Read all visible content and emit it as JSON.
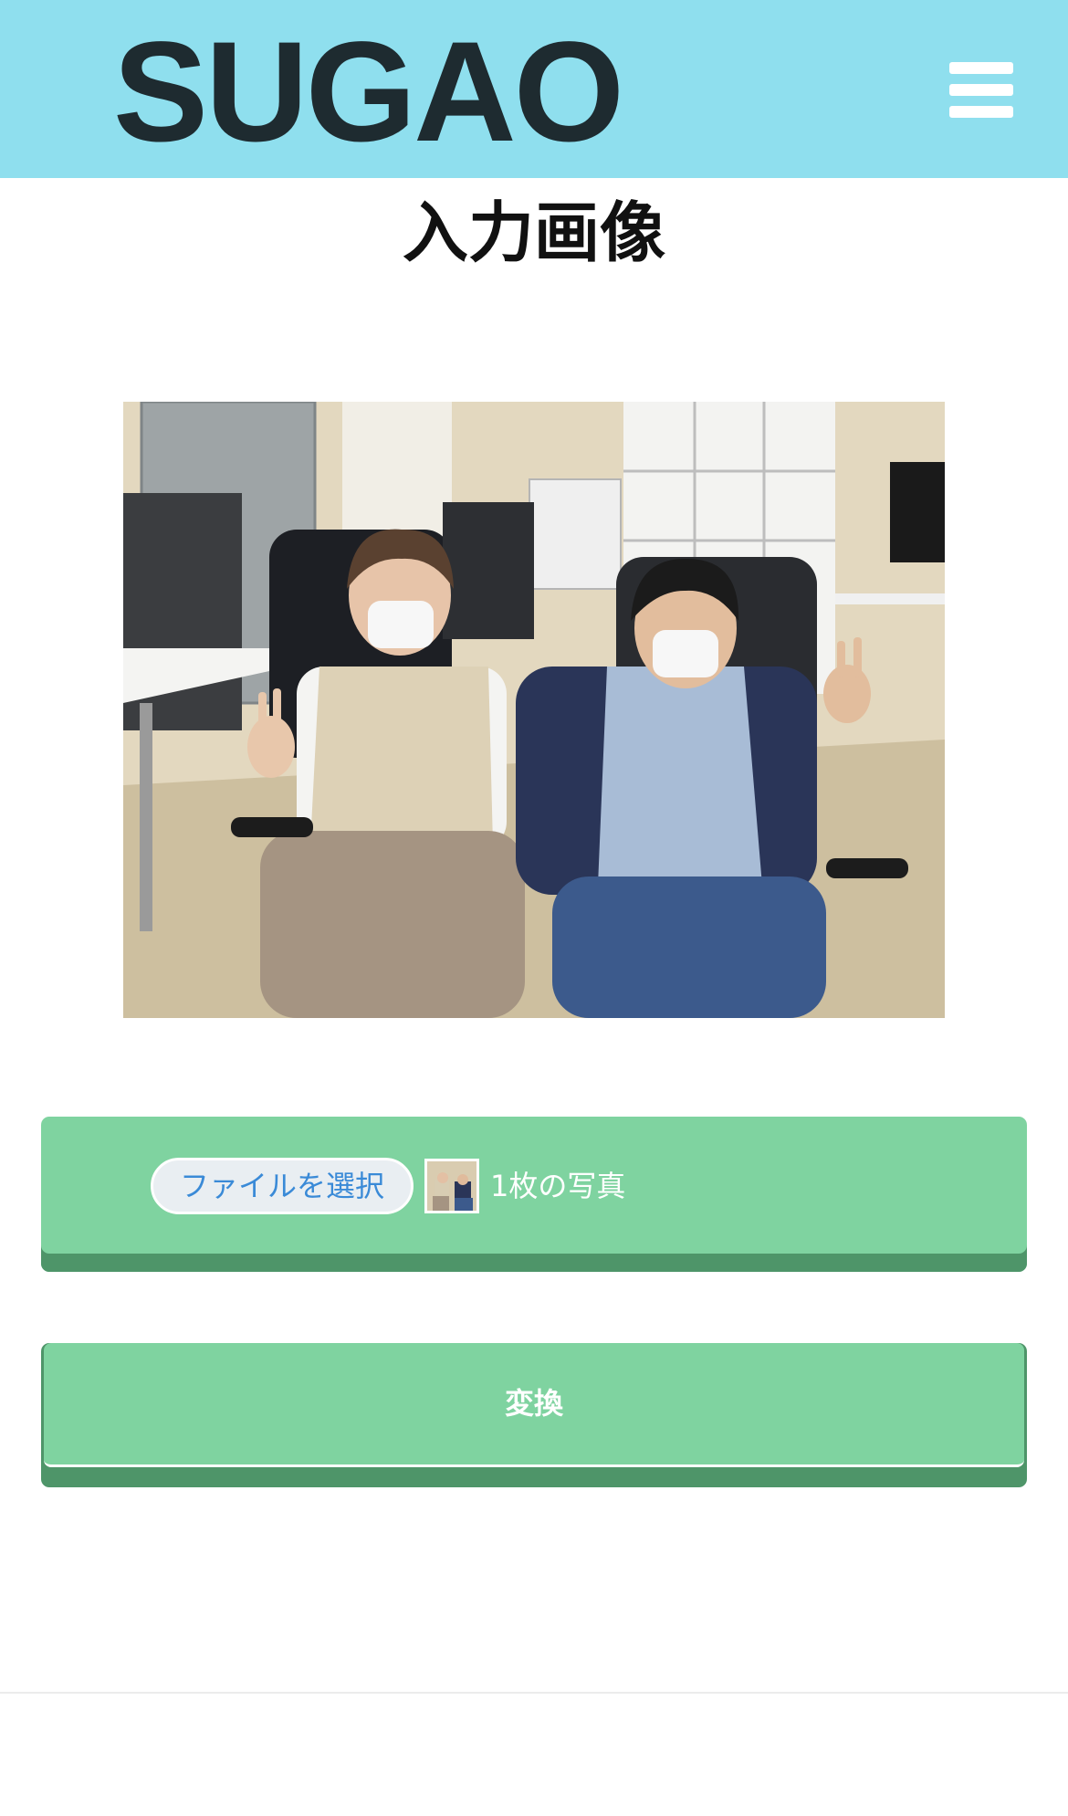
{
  "header": {
    "logo": "SUGAO",
    "menu_icon": "hamburger-menu-icon",
    "background_color": "#8fdfee"
  },
  "main": {
    "title": "入力画像",
    "photo_description": "two-people-in-office-photo"
  },
  "file_input": {
    "button_label": "ファイルを選択",
    "selected_count": "1枚の写真",
    "panel_color": "#7fd3a0"
  },
  "convert": {
    "label": "変換"
  }
}
